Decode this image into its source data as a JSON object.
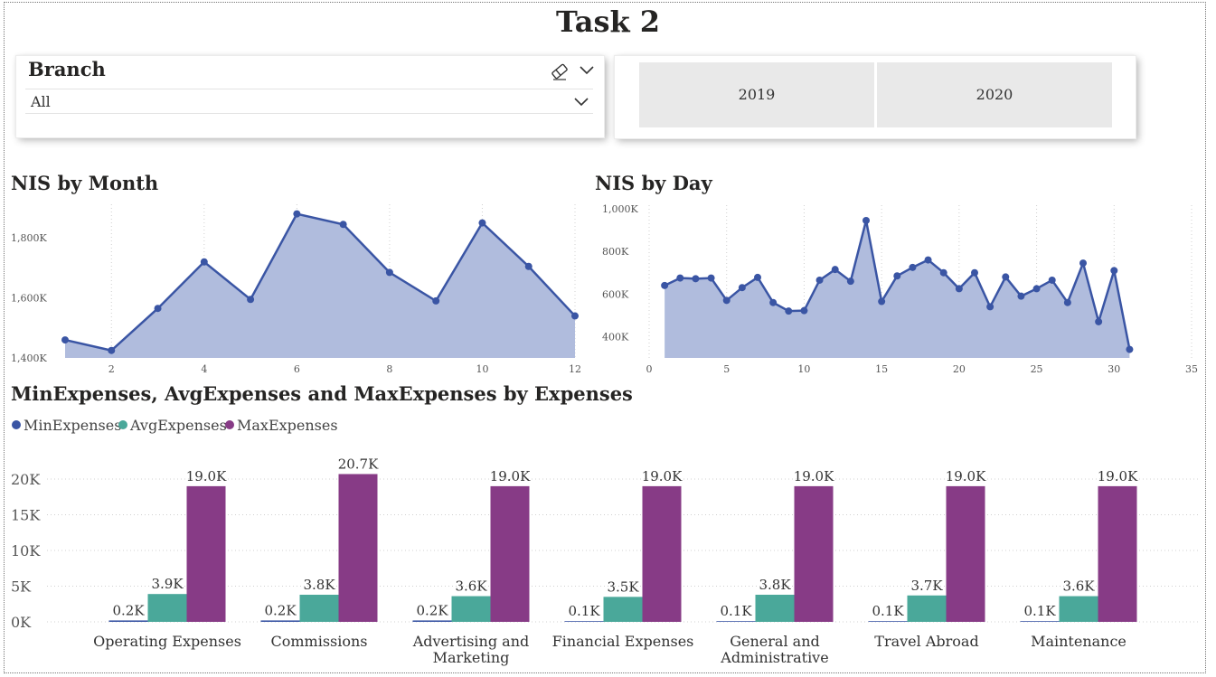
{
  "page": {
    "title": "Task 2"
  },
  "branch_slicer": {
    "title": "Branch",
    "value": "All"
  },
  "year_slicer": {
    "options": [
      "2019",
      "2020"
    ]
  },
  "colors": {
    "area_line": "#3A55A4",
    "area_fill": "#B0BCDD",
    "min": "#3A55A4",
    "avg": "#4AA89A",
    "max": "#873B86",
    "grid": "#d0d0d0",
    "axis_text": "#555555"
  },
  "chart_data": [
    {
      "id": "nis_by_month",
      "type": "area",
      "title": "NIS by Month",
      "x": [
        1,
        2,
        3,
        4,
        5,
        6,
        7,
        8,
        9,
        10,
        11,
        12
      ],
      "values": [
        1460000,
        1425000,
        1565000,
        1720000,
        1595000,
        1880000,
        1845000,
        1685000,
        1590000,
        1850000,
        1705000,
        1540000
      ],
      "xlim": [
        1,
        12
      ],
      "ylim": [
        1400000,
        1900000
      ],
      "x_ticks": [
        2,
        4,
        6,
        8,
        10,
        12
      ],
      "y_ticks": [
        1400000,
        1600000,
        1800000
      ],
      "y_tick_labels": [
        "1,400K",
        "1,600K",
        "1,800K"
      ],
      "grid": "vertical dotted"
    },
    {
      "id": "nis_by_day",
      "type": "area",
      "title": "NIS by Day",
      "x": [
        1,
        2,
        3,
        4,
        5,
        6,
        7,
        8,
        9,
        10,
        11,
        12,
        13,
        14,
        15,
        16,
        17,
        18,
        19,
        20,
        21,
        22,
        23,
        24,
        25,
        26,
        27,
        28,
        29,
        30,
        31
      ],
      "values": [
        640000,
        675000,
        672000,
        675000,
        570000,
        630000,
        678000,
        560000,
        520000,
        522000,
        665000,
        715000,
        660000,
        945000,
        565000,
        685000,
        725000,
        760000,
        700000,
        625000,
        700000,
        540000,
        680000,
        590000,
        625000,
        665000,
        560000,
        745000,
        470000,
        710000,
        340000
      ],
      "xlim": [
        0,
        35
      ],
      "ylim": [
        300000,
        1000000
      ],
      "x_ticks": [
        0,
        5,
        10,
        15,
        20,
        25,
        30,
        35
      ],
      "y_ticks": [
        400000,
        600000,
        800000,
        1000000
      ],
      "y_tick_labels": [
        "400K",
        "600K",
        "800K",
        "1,000K"
      ],
      "grid": "vertical dotted"
    },
    {
      "id": "expenses",
      "type": "bar",
      "title": "MinExpenses, AvgExpenses and MaxExpenses by Expenses",
      "categories": [
        [
          "Operating Expenses"
        ],
        [
          "Commissions"
        ],
        [
          "Advertising and",
          "Marketing"
        ],
        [
          "Financial Expenses"
        ],
        [
          "General and",
          "Administrative"
        ],
        [
          "Travel Abroad"
        ],
        [
          "Maintenance"
        ]
      ],
      "series": [
        {
          "name": "MinExpenses",
          "values": [
            200,
            200,
            200,
            100,
            100,
            100,
            100
          ],
          "labels": [
            "0.2K",
            "0.2K",
            "0.2K",
            "0.1K",
            "0.1K",
            "0.1K",
            "0.1K"
          ]
        },
        {
          "name": "AvgExpenses",
          "values": [
            3900,
            3800,
            3600,
            3500,
            3800,
            3700,
            3600
          ],
          "labels": [
            "3.9K",
            "3.8K",
            "3.6K",
            "3.5K",
            "3.8K",
            "3.7K",
            "3.6K"
          ]
        },
        {
          "name": "MaxExpenses",
          "values": [
            19000,
            20700,
            19000,
            19000,
            19000,
            19000,
            19000
          ],
          "labels": [
            "19.0K",
            "20.7K",
            "19.0K",
            "19.0K",
            "19.0K",
            "19.0K",
            "19.0K"
          ]
        }
      ],
      "ylim": [
        0,
        20000
      ],
      "y_ticks": [
        0,
        5000,
        10000,
        15000,
        20000
      ],
      "y_tick_labels": [
        "0K",
        "5K",
        "10K",
        "15K",
        "20K"
      ],
      "legend": "top-left",
      "grid": "horizontal dotted"
    }
  ]
}
